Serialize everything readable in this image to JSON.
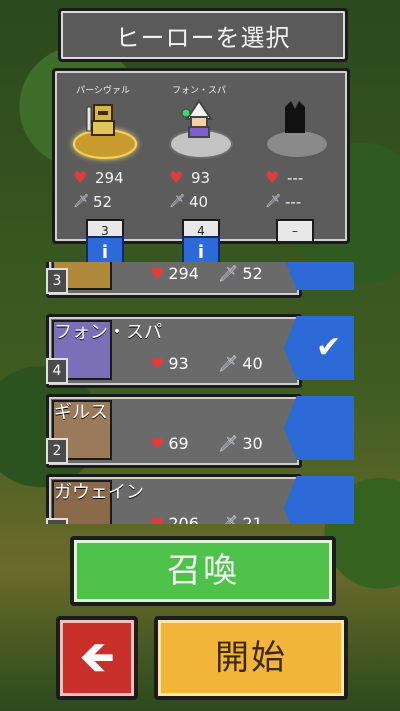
{
  "title": "ヒーローを選択",
  "selected_slots": [
    {
      "name": "パーシヴァル",
      "hp": "294",
      "atk": "52",
      "level": "3",
      "info": "i",
      "portrait": "golden-knight"
    },
    {
      "name": "フォン・スパ",
      "hp": "93",
      "atk": "40",
      "level": "4",
      "info": "i",
      "portrait": "white-mage"
    },
    {
      "name": "",
      "hp": "---",
      "atk": "---",
      "level": "–",
      "info": "",
      "portrait": "empty-silhouette"
    }
  ],
  "list": [
    {
      "name": "",
      "hp": "294",
      "atk": "52",
      "level": "3",
      "selected": true
    },
    {
      "name": "フォン・スパ",
      "hp": "93",
      "atk": "40",
      "level": "4",
      "selected": true,
      "check": "✔"
    },
    {
      "name": "ギルス",
      "hp": "69",
      "atk": "30",
      "level": "2",
      "selected": false
    },
    {
      "name": "ガウェイン",
      "hp": "206",
      "atk": "21",
      "level": "",
      "selected": false
    }
  ],
  "buttons": {
    "summon": "召喚",
    "back": "🡸",
    "start": "開始"
  },
  "icons": {
    "heart": "♥",
    "sword": "🗡"
  },
  "colors": {
    "blue": "#2d6ad8",
    "green": "#4fc24b",
    "red": "#c9302c",
    "yellow": "#f3b43a"
  }
}
